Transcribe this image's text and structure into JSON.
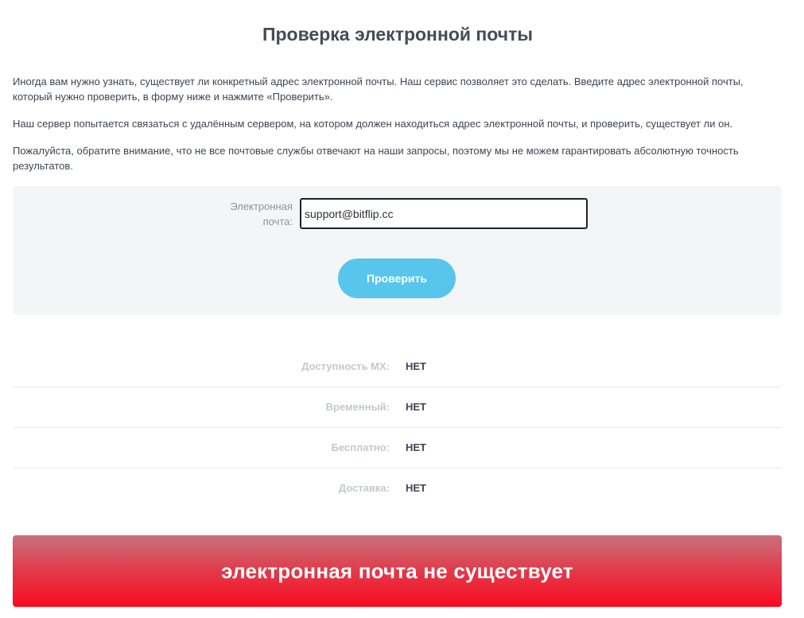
{
  "title": "Проверка электронной почты",
  "intro": {
    "p1": "Иногда вам нужно узнать, существует ли конкретный адрес электронной почты. Наш сервис позволяет это сделать. Введите адрес электронной почты, который нужно проверить, в форму ниже и нажмите «Проверить».",
    "p2": "Наш сервер попытается связаться с удалённым сервером, на котором должен находиться адрес электронной почты, и проверить, существует ли он.",
    "p3": "Пожалуйста, обратите внимание, что не все почтовые службы отвечают на наши запросы, поэтому мы не можем гарантировать абсолютную точность результатов."
  },
  "form": {
    "email_label": "Электронная почта:",
    "email_value": "support@bitflip.cc",
    "submit_label": "Проверить"
  },
  "results": [
    {
      "label": "Доступность MX:",
      "value": "НЕТ"
    },
    {
      "label": "Временный:",
      "value": "НЕТ"
    },
    {
      "label": "Бесплатно:",
      "value": "НЕТ"
    },
    {
      "label": "Доставка:",
      "value": "НЕТ"
    }
  ],
  "status": {
    "message": "электронная почта не существует"
  },
  "colors": {
    "button": "#58c6ec",
    "panel_background": "#f3f6f7",
    "banner_top": "#c7717d",
    "banner_bottom": "#fb0a20"
  }
}
